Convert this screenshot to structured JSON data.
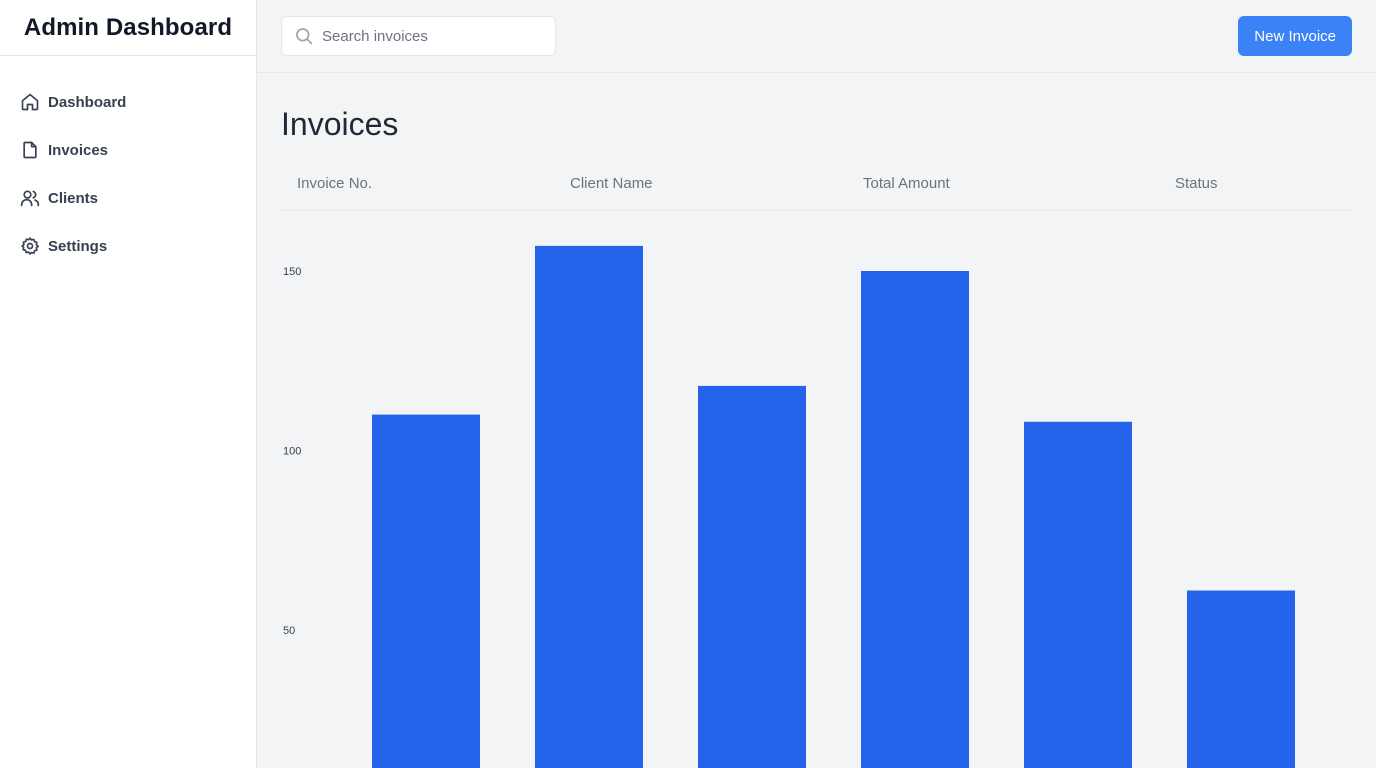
{
  "app": {
    "title": "Admin Dashboard"
  },
  "sidebar": {
    "items": [
      {
        "label": "Dashboard",
        "icon": "home-icon"
      },
      {
        "label": "Invoices",
        "icon": "file-icon"
      },
      {
        "label": "Clients",
        "icon": "users-icon"
      },
      {
        "label": "Settings",
        "icon": "gear-icon"
      }
    ]
  },
  "header": {
    "search_placeholder": "Search invoices",
    "search_value": "",
    "new_button_label": "New Invoice"
  },
  "main": {
    "title": "Invoices",
    "columns": [
      "Invoice No.",
      "Client Name",
      "Total Amount",
      "Status"
    ]
  },
  "colors": {
    "accent": "#3b82f6",
    "bar": "#2563eb",
    "background": "#f3f4f6",
    "sidebar": "#ffffff"
  },
  "chart_data": {
    "type": "bar",
    "categories": [],
    "values": [
      110,
      157,
      118,
      150,
      108,
      61
    ],
    "y_ticks": [
      50,
      100,
      150
    ],
    "y_visible_range": [
      14,
      157
    ],
    "title": "",
    "xlabel": "",
    "ylabel": "",
    "grid": false,
    "legend": "none"
  }
}
